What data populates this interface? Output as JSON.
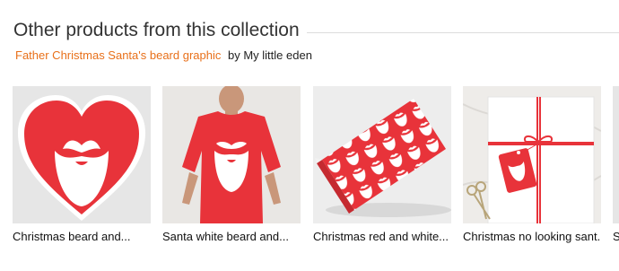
{
  "section": {
    "title": "Other products from this collection"
  },
  "collection": {
    "link_label": "Father Christmas Santa's beard graphic",
    "by_text": "by My little eden"
  },
  "products": [
    {
      "name": "Christmas beard and...",
      "icon": "heart-sticker"
    },
    {
      "name": "Santa white beard and...",
      "icon": "t-shirt"
    },
    {
      "name": "Christmas red and white...",
      "icon": "wrapping-paper"
    },
    {
      "name": "Christmas no looking sant...",
      "icon": "gift-tag"
    },
    {
      "name": "S",
      "icon": "product-thumbnail"
    }
  ],
  "colors": {
    "accent": "#e8701a",
    "santa_red": "#e8333a",
    "white": "#ffffff"
  }
}
